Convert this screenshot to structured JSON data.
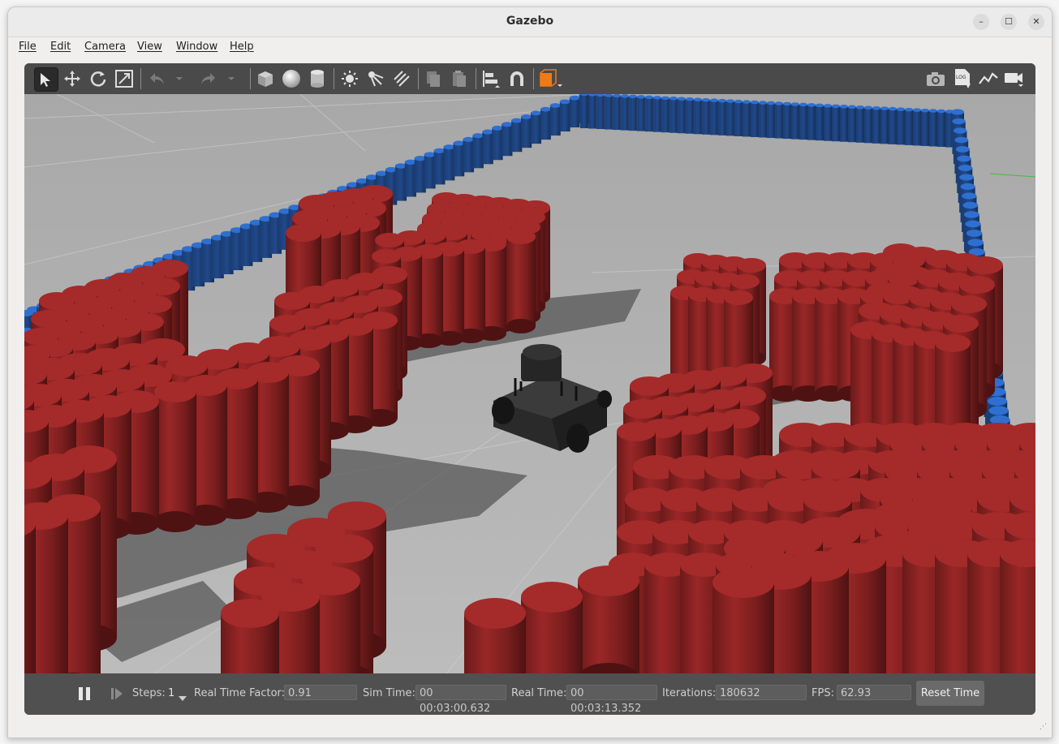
{
  "window": {
    "title": "Gazebo"
  },
  "window_controls": {
    "minimize": "–",
    "maximize": "☐",
    "close": "✕"
  },
  "menu": [
    {
      "label": "File"
    },
    {
      "label": "Edit"
    },
    {
      "label": "Camera"
    },
    {
      "label": "View"
    },
    {
      "label": "Window"
    },
    {
      "label": "Help"
    }
  ],
  "toolbar": {
    "left_tools": [
      "select-arrow-icon",
      "translate-icon",
      "rotate-icon",
      "scale-icon",
      "undo-icon",
      "undo-history-icon",
      "redo-icon",
      "redo-history-icon",
      "box-icon",
      "sphere-icon",
      "cylinder-icon",
      "point-light-icon",
      "spot-light-icon",
      "directional-light-icon",
      "copy-icon",
      "paste-icon",
      "align-icon",
      "snap-icon",
      "change-view-icon"
    ],
    "right_tools": [
      "screenshot-icon",
      "log-icon",
      "plot-icon",
      "video-record-icon"
    ]
  },
  "bottom_bar": {
    "steps_label": "Steps:",
    "steps_value": "1",
    "rtf_label": "Real Time Factor:",
    "rtf_value": "0.91",
    "sim_time_label": "Sim Time:",
    "sim_time_value": "00 00:03:00.632",
    "real_time_label": "Real Time:",
    "real_time_value": "00 00:03:13.352",
    "iterations_label": "Iterations:",
    "iterations_value": "180632",
    "fps_label": "FPS:",
    "fps_value": "62.93",
    "reset_label": "Reset Time"
  },
  "colors": {
    "obstacle": "#a52a2a",
    "wall": "#2e6fd1",
    "ground": "#b6b6b6",
    "robot": "#2a2a2a"
  }
}
